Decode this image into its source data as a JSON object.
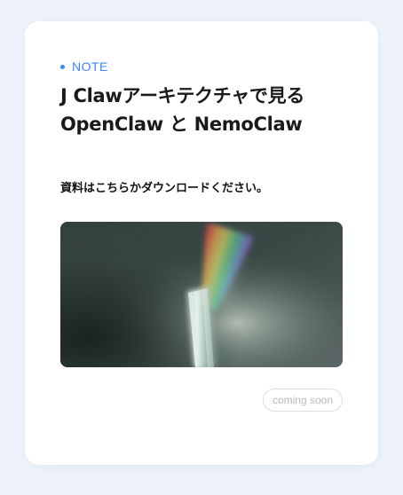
{
  "card": {
    "tag": "NOTE",
    "title_line1": "J Clawアーキテクチャで見る",
    "title_line2": "OpenClaw と NemoClaw",
    "description": "資料はこちらかダウンロードください。",
    "image": {
      "subject": "prism-rainbow-light-photo"
    },
    "button": {
      "label": "coming soon",
      "state": "disabled"
    }
  },
  "colors": {
    "accent": "#3f87ff",
    "title": "#1a1a1a",
    "button_text": "#b9b9b9",
    "background": "#eef3fb"
  }
}
